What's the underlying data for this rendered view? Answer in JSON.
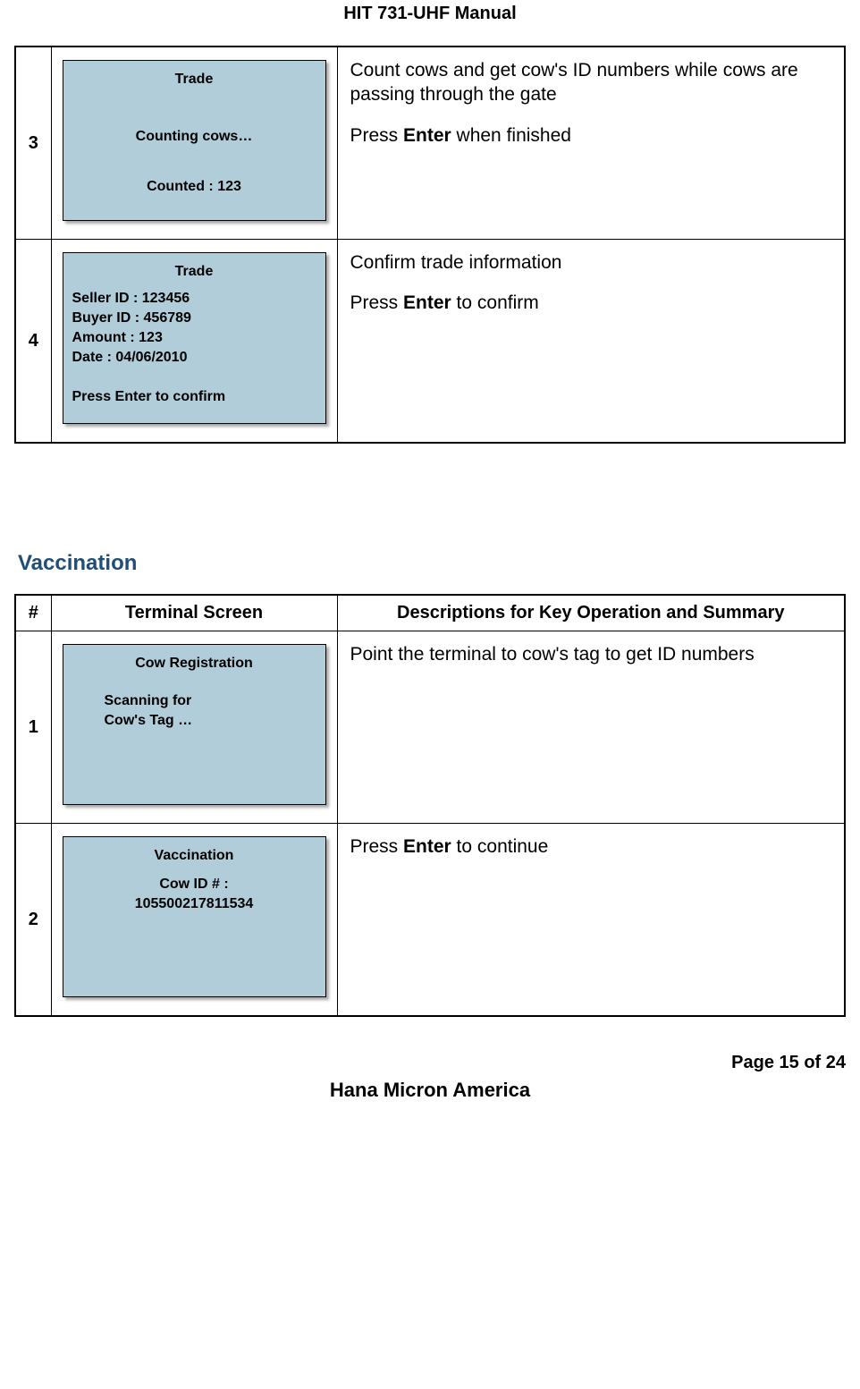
{
  "header": {
    "title": "HIT 731-UHF Manual"
  },
  "table1": {
    "rows": [
      {
        "num": "3",
        "screen": {
          "title": "Trade",
          "action": "Counting cows…",
          "counted": "Counted : 123"
        },
        "desc": {
          "line1": "Count cows and get cow's ID numbers while cows are passing through the gate",
          "line2_pre": "Press ",
          "line2_bold": "Enter",
          "line2_post": " when finished"
        }
      },
      {
        "num": "4",
        "screen": {
          "title": "Trade",
          "seller": "Seller ID : 123456",
          "buyer": "Buyer ID : 456789",
          "amount": "Amount : 123",
          "date": "Date : 04/06/2010",
          "prompt": "Press Enter to confirm"
        },
        "desc": {
          "line1": "Confirm trade information",
          "line2_pre": "Press ",
          "line2_bold": "Enter",
          "line2_post": " to confirm"
        }
      }
    ]
  },
  "section": {
    "heading": "Vaccination"
  },
  "table2": {
    "headers": {
      "num": "#",
      "screen": "Terminal Screen",
      "desc": "Descriptions for Key Operation and Summary"
    },
    "rows": [
      {
        "num": "1",
        "screen": {
          "title": "Cow Registration",
          "line1": "Scanning for",
          "line2": "Cow's Tag …"
        },
        "desc": {
          "line1": "Point the terminal to cow's tag to get ID numbers"
        }
      },
      {
        "num": "2",
        "screen": {
          "title": "Vaccination",
          "line1": "Cow ID # :",
          "line2": "105500217811534"
        },
        "desc": {
          "line2_pre": "Press ",
          "line2_bold": "Enter",
          "line2_post": " to continue"
        }
      }
    ]
  },
  "footer": {
    "page": "Page 15 of 24",
    "company": "Hana Micron America"
  }
}
